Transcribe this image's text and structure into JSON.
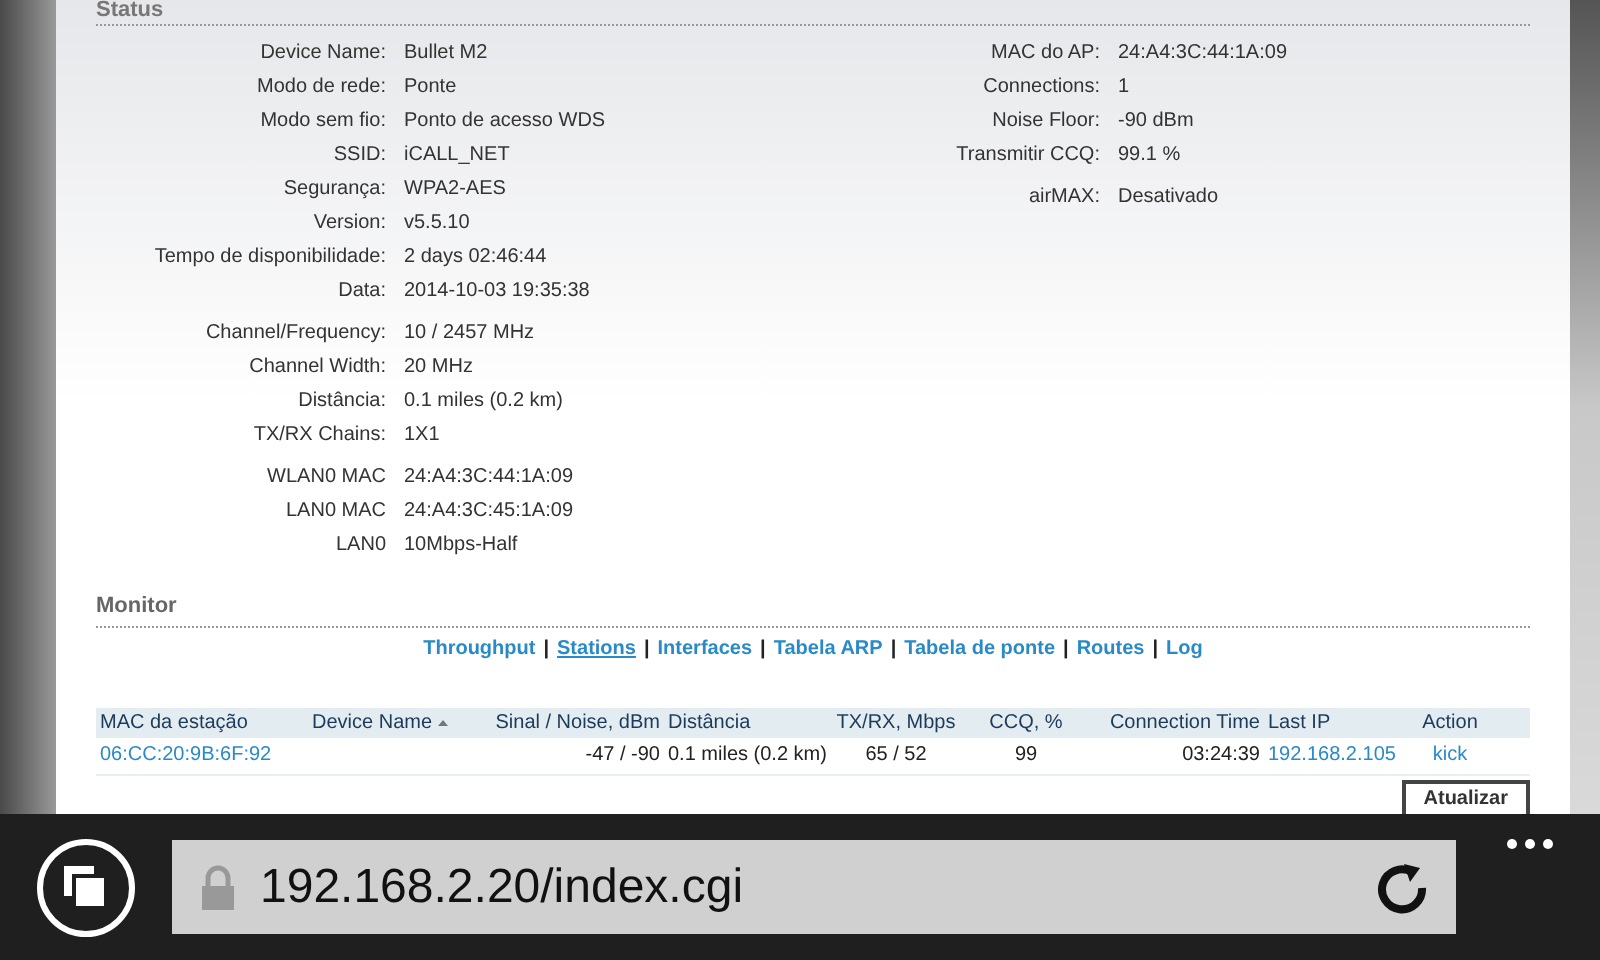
{
  "status": {
    "title": "Status",
    "left_groups": [
      [
        {
          "label": "Device Name:",
          "value": "Bullet M2"
        },
        {
          "label": "Modo de rede:",
          "value": "Ponte"
        },
        {
          "label": "Modo sem fio:",
          "value": "Ponto de acesso WDS"
        },
        {
          "label": "SSID:",
          "value": "iCALL_NET"
        },
        {
          "label": "Segurança:",
          "value": "WPA2-AES"
        },
        {
          "label": "Version:",
          "value": "v5.5.10"
        },
        {
          "label": "Tempo de disponibilidade:",
          "value": "2 days 02:46:44"
        },
        {
          "label": "Data:",
          "value": "2014-10-03 19:35:38"
        }
      ],
      [
        {
          "label": "Channel/Frequency:",
          "value": "10 / 2457 MHz"
        },
        {
          "label": "Channel Width:",
          "value": "20 MHz"
        },
        {
          "label": "Distância:",
          "value": "0.1 miles (0.2 km)"
        },
        {
          "label": "TX/RX Chains:",
          "value": "1X1"
        }
      ],
      [
        {
          "label": "WLAN0 MAC",
          "value": "24:A4:3C:44:1A:09"
        },
        {
          "label": "LAN0 MAC",
          "value": "24:A4:3C:45:1A:09"
        },
        {
          "label": "LAN0",
          "value": "10Mbps-Half"
        }
      ]
    ],
    "right_groups": [
      [
        {
          "label": "MAC do AP:",
          "value": "24:A4:3C:44:1A:09"
        },
        {
          "label": "Connections:",
          "value": "1"
        },
        {
          "label": "Noise Floor:",
          "value": "-90 dBm"
        },
        {
          "label": "Transmitir CCQ:",
          "value": "99.1 %"
        }
      ],
      [
        {
          "label": "airMAX:",
          "value": "Desativado"
        }
      ]
    ]
  },
  "monitor": {
    "title": "Monitor",
    "links": [
      {
        "label": "Throughput",
        "selected": false
      },
      {
        "separator": "|",
        "label": "Stations",
        "selected": true
      },
      {
        "separator": "|",
        "label": "Interfaces",
        "selected": false
      },
      {
        "separator": "|",
        "label": "Tabela ARP",
        "selected": false
      },
      {
        "separator": "|",
        "label": "Tabela de ponte",
        "selected": false
      },
      {
        "separator": "|",
        "label": "Routes",
        "selected": false
      },
      {
        "separator": "|",
        "label": "Log",
        "selected": false
      }
    ],
    "table": {
      "columns": [
        {
          "label": "MAC da estação",
          "sorted": false
        },
        {
          "label": "Device Name",
          "sorted": true
        },
        {
          "label": "Sinal / Noise, dBm",
          "sorted": false
        },
        {
          "label": "Distância",
          "sorted": false
        },
        {
          "label": "TX/RX, Mbps",
          "sorted": false
        },
        {
          "label": "CCQ, %",
          "sorted": false
        },
        {
          "label": "Connection Time",
          "sorted": false
        },
        {
          "label": "Last IP",
          "sorted": false
        },
        {
          "label": "Action",
          "sorted": false
        }
      ],
      "rows": [
        [
          {
            "kind": "link",
            "text": "06:CC:20:9B:6F:92"
          },
          {
            "kind": "empty"
          },
          {
            "kind": "text",
            "text": "-47 / -90"
          },
          {
            "kind": "text",
            "text": "0.1 miles (0.2 km)"
          },
          {
            "kind": "text",
            "text": "65 / 52"
          },
          {
            "kind": "text",
            "text": "99"
          },
          {
            "kind": "text",
            "text": "03:24:39"
          },
          {
            "kind": "link",
            "text": "192.168.2.105"
          },
          {
            "kind": "link",
            "text": "kick"
          }
        ]
      ]
    },
    "refresh_button": "Atualizar"
  },
  "browser": {
    "url": "192.168.2.20/index.cgi"
  }
}
